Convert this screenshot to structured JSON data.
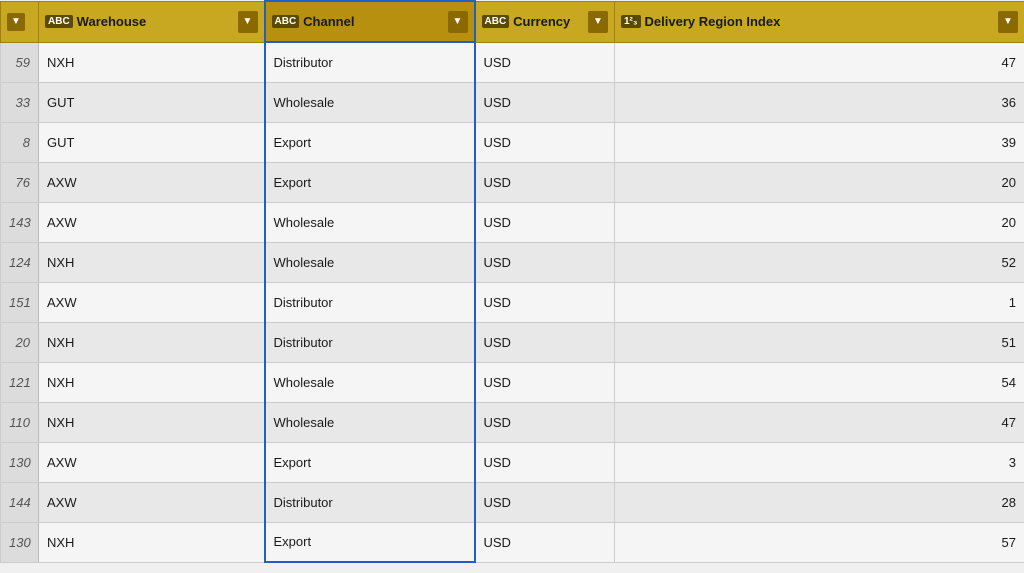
{
  "columns": [
    {
      "id": "index",
      "label": "",
      "type": "index",
      "icon": null
    },
    {
      "id": "warehouse",
      "label": "Warehouse",
      "type": "text",
      "icon": "abc"
    },
    {
      "id": "channel",
      "label": "Channel",
      "type": "text",
      "icon": "abc",
      "active": true
    },
    {
      "id": "currency",
      "label": "Currency",
      "type": "text",
      "icon": "abc"
    },
    {
      "id": "delivery",
      "label": "Delivery Region Index",
      "type": "number",
      "icon": "num"
    }
  ],
  "rows": [
    {
      "index": 59,
      "warehouse": "NXH",
      "channel": "Distributor",
      "currency": "USD",
      "delivery": 47
    },
    {
      "index": 33,
      "warehouse": "GUT",
      "channel": "Wholesale",
      "currency": "USD",
      "delivery": 36
    },
    {
      "index": 8,
      "warehouse": "GUT",
      "channel": "Export",
      "currency": "USD",
      "delivery": 39
    },
    {
      "index": 76,
      "warehouse": "AXW",
      "channel": "Export",
      "currency": "USD",
      "delivery": 20
    },
    {
      "index": 143,
      "warehouse": "AXW",
      "channel": "Wholesale",
      "currency": "USD",
      "delivery": 20
    },
    {
      "index": 124,
      "warehouse": "NXH",
      "channel": "Wholesale",
      "currency": "USD",
      "delivery": 52
    },
    {
      "index": 151,
      "warehouse": "AXW",
      "channel": "Distributor",
      "currency": "USD",
      "delivery": 1
    },
    {
      "index": 20,
      "warehouse": "NXH",
      "channel": "Distributor",
      "currency": "USD",
      "delivery": 51
    },
    {
      "index": 121,
      "warehouse": "NXH",
      "channel": "Wholesale",
      "currency": "USD",
      "delivery": 54
    },
    {
      "index": 110,
      "warehouse": "NXH",
      "channel": "Wholesale",
      "currency": "USD",
      "delivery": 47
    },
    {
      "index": 130,
      "warehouse": "AXW",
      "channel": "Export",
      "currency": "USD",
      "delivery": 3
    },
    {
      "index": 144,
      "warehouse": "AXW",
      "channel": "Distributor",
      "currency": "USD",
      "delivery": 28
    },
    {
      "index": 130,
      "warehouse": "NXH",
      "channel": "Export",
      "currency": "USD",
      "delivery": 57
    }
  ],
  "icons": {
    "abc": "ABC",
    "num": "123",
    "dropdown": "▼",
    "sort": "▼"
  }
}
